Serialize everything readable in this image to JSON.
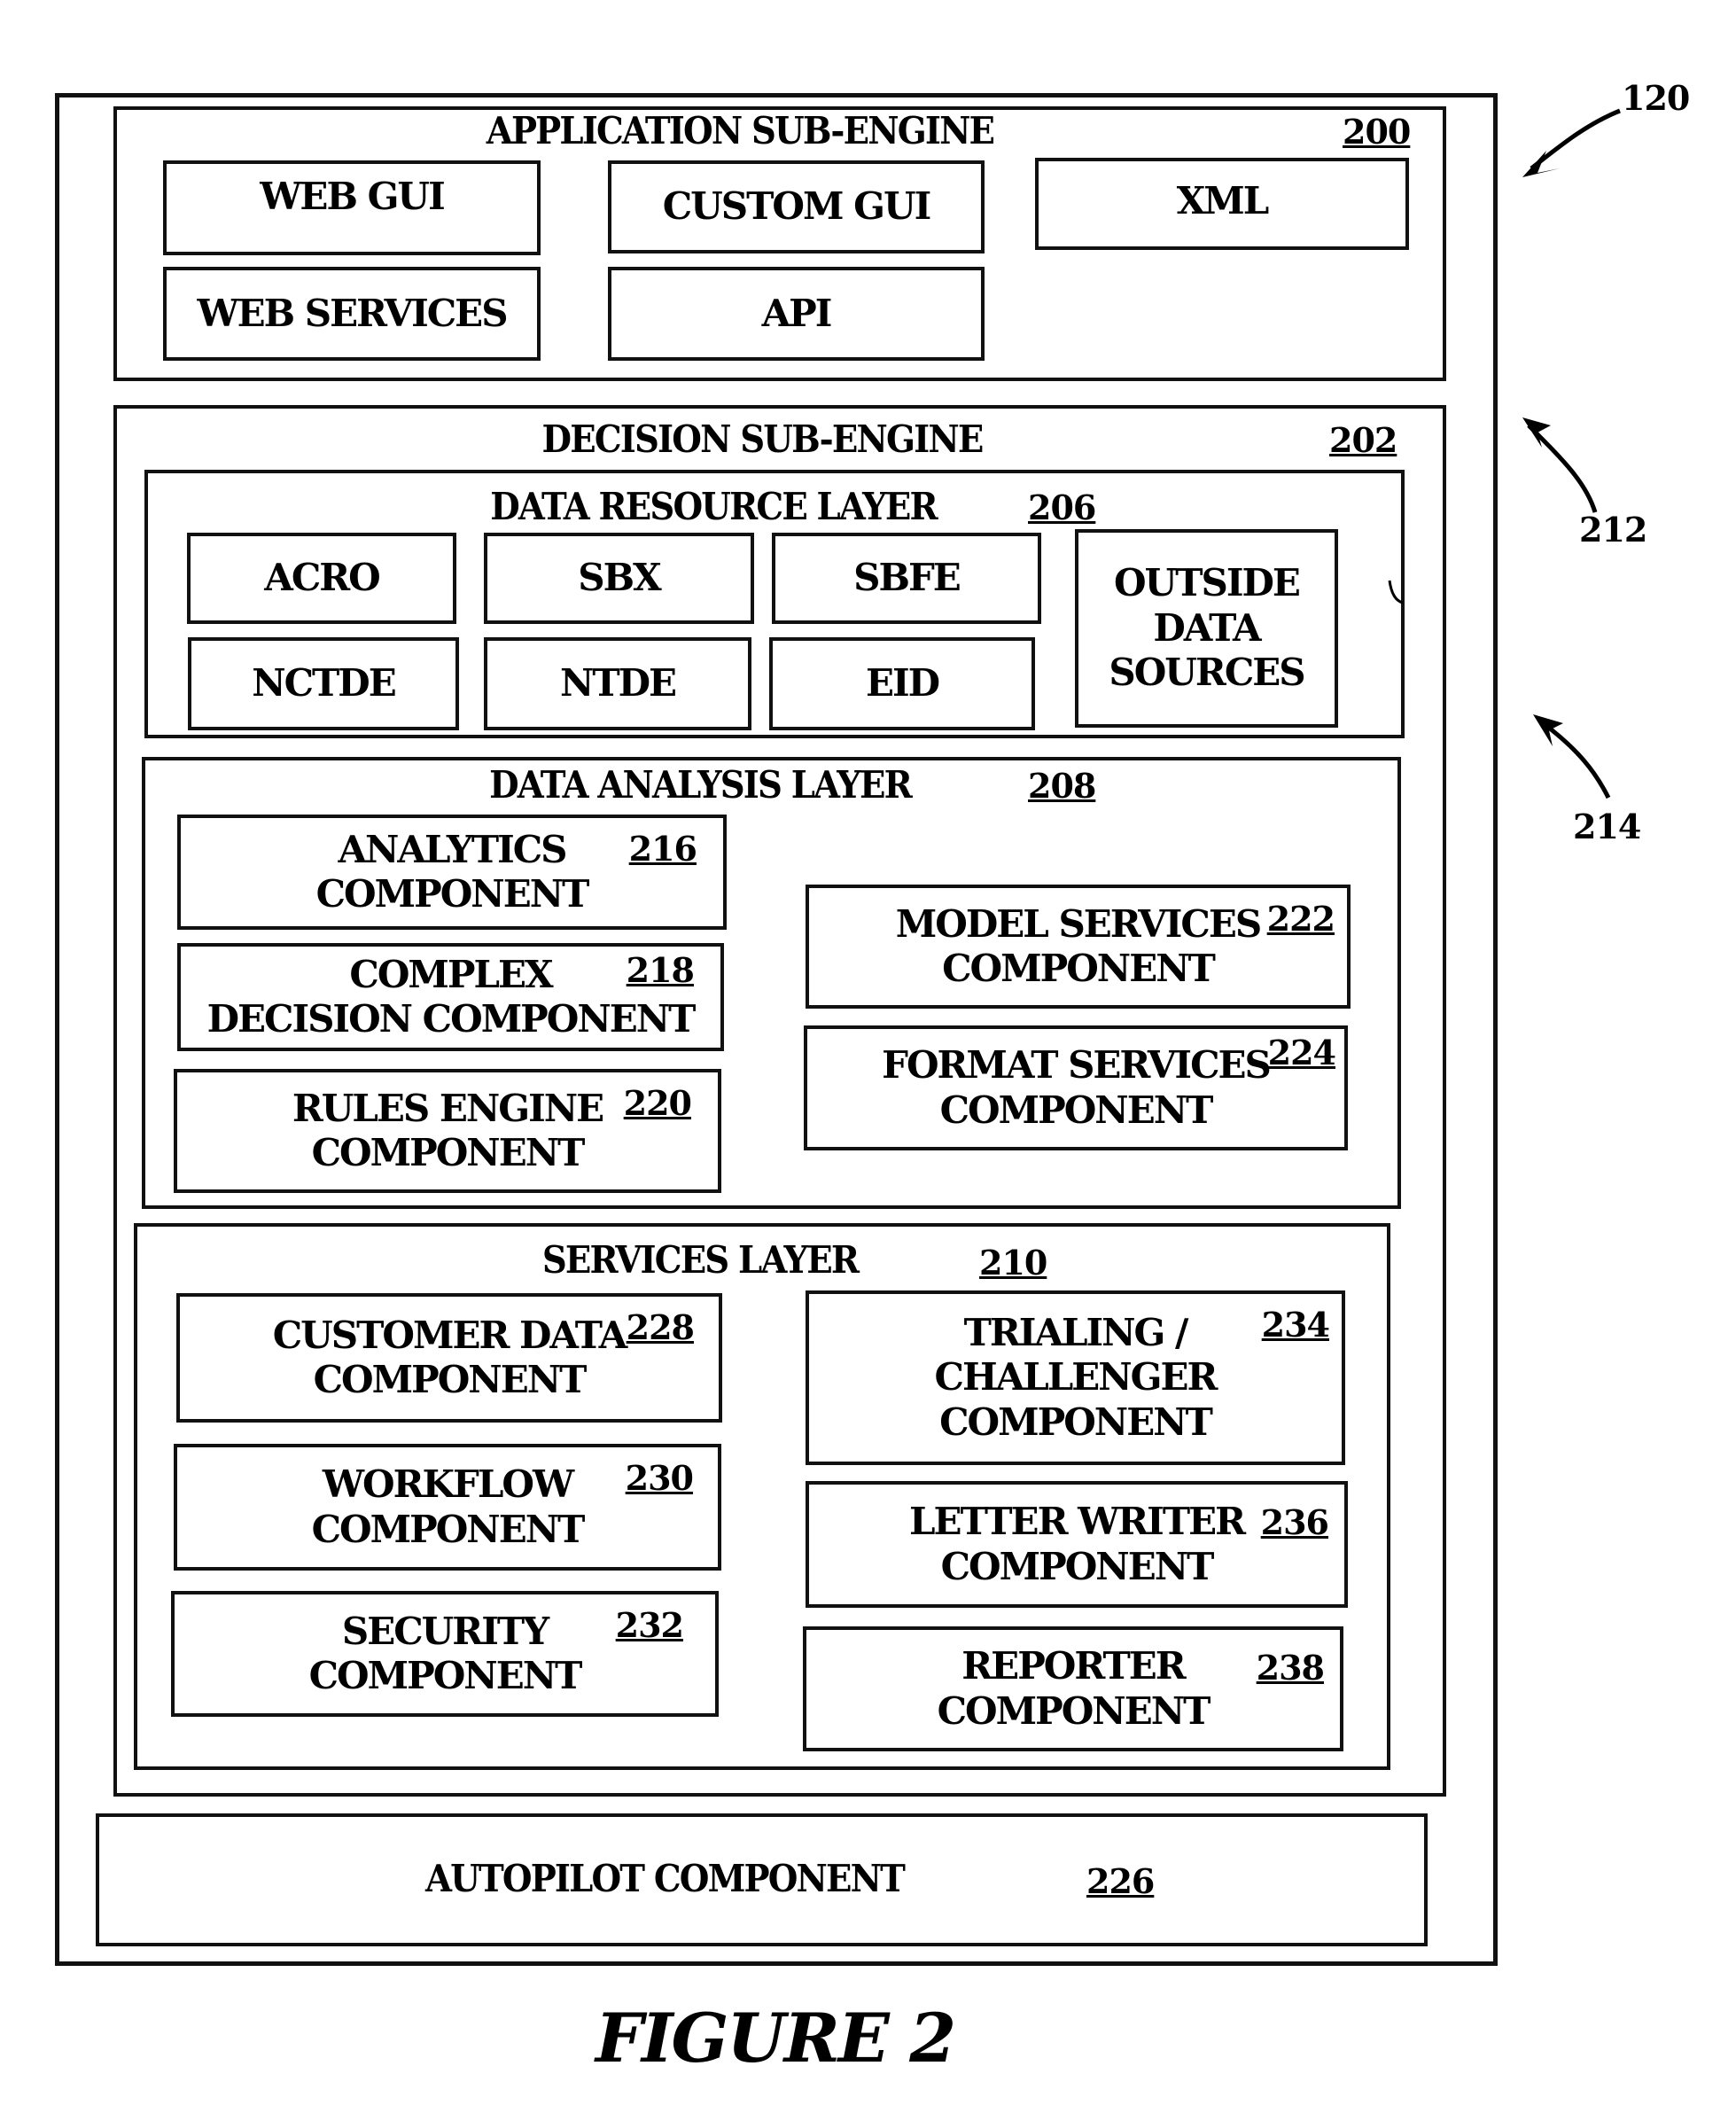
{
  "figure": {
    "caption": "FIGURE 2",
    "system_ref": "120",
    "callouts": [
      "120",
      "212",
      "214"
    ]
  },
  "application_sub_engine": {
    "title": "APPLICATION SUB-ENGINE",
    "ref": "200",
    "items": [
      "WEB GUI",
      "CUSTOM GUI",
      "XML",
      "WEB SERVICES",
      "API"
    ]
  },
  "decision_sub_engine": {
    "title": "DECISION SUB-ENGINE",
    "ref": "202",
    "data_resource_layer": {
      "title": "DATA RESOURCE LAYER",
      "ref": "206",
      "items": [
        "ACRO",
        "SBX",
        "SBFE",
        "OUTSIDE\nDATA\nSOURCES",
        "NCTDE",
        "NTDE",
        "EID"
      ]
    },
    "data_analysis_layer": {
      "title": "DATA ANALYSIS LAYER",
      "ref": "208",
      "components": [
        {
          "label": "ANALYTICS\nCOMPONENT",
          "ref": "216"
        },
        {
          "label": "COMPLEX\nDECISION COMPONENT",
          "ref": "218"
        },
        {
          "label": "RULES ENGINE\nCOMPONENT",
          "ref": "220"
        },
        {
          "label": "MODEL SERVICES\nCOMPONENT",
          "ref": "222"
        },
        {
          "label": "FORMAT SERVICES\nCOMPONENT",
          "ref": "224"
        }
      ]
    },
    "services_layer": {
      "title": "SERVICES LAYER",
      "ref": "210",
      "components": [
        {
          "label": "CUSTOMER DATA\nCOMPONENT",
          "ref": "228"
        },
        {
          "label": "WORKFLOW\nCOMPONENT",
          "ref": "230"
        },
        {
          "label": "SECURITY\nCOMPONENT",
          "ref": "232"
        },
        {
          "label": "TRIALING /\nCHALLENGER\nCOMPONENT",
          "ref": "234"
        },
        {
          "label": "LETTER WRITER\nCOMPONENT",
          "ref": "236"
        },
        {
          "label": "REPORTER\nCOMPONENT",
          "ref": "238"
        }
      ]
    }
  },
  "autopilot": {
    "label": "AUTOPILOT COMPONENT",
    "ref": "226"
  }
}
